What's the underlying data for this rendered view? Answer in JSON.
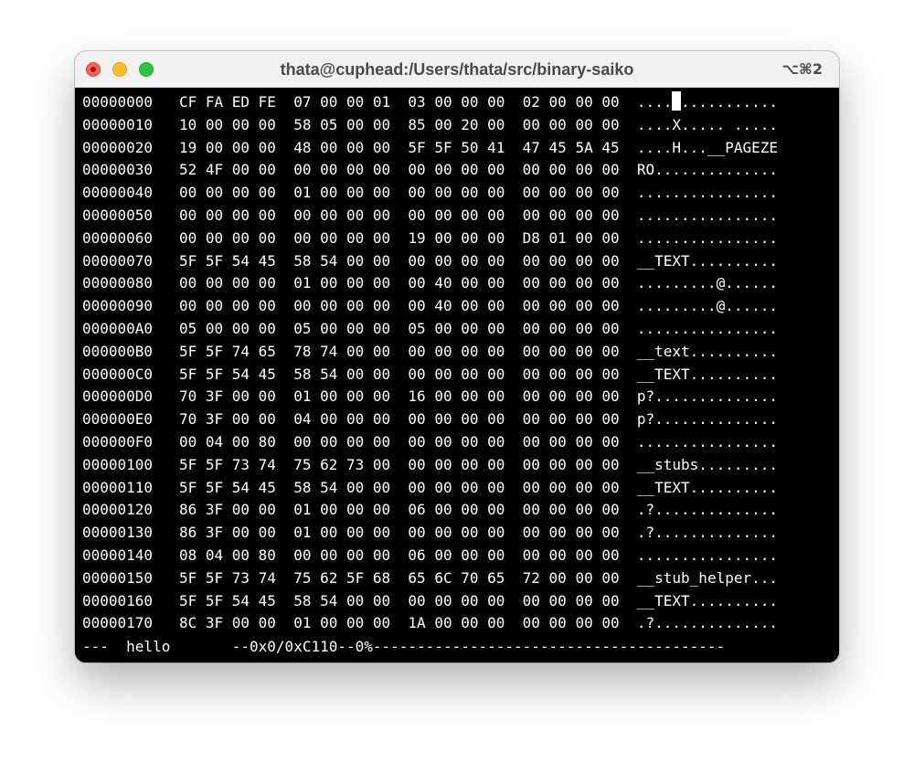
{
  "window": {
    "title": "thata@cuphead:/Users/thata/src/binary-saiko",
    "shortcut": "⌥⌘2"
  },
  "hexdump": {
    "rows": [
      {
        "addr": "00000000",
        "hex": "CF FA ED FE  07 00 00 01  03 00 00 00  02 00 00 00",
        "ascii": "................"
      },
      {
        "addr": "00000010",
        "hex": "10 00 00 00  58 05 00 00  85 00 20 00  00 00 00 00",
        "ascii": "....X..... ....."
      },
      {
        "addr": "00000020",
        "hex": "19 00 00 00  48 00 00 00  5F 5F 50 41  47 45 5A 45",
        "ascii": "....H...__PAGEZE"
      },
      {
        "addr": "00000030",
        "hex": "52 4F 00 00  00 00 00 00  00 00 00 00  00 00 00 00",
        "ascii": "RO.............."
      },
      {
        "addr": "00000040",
        "hex": "00 00 00 00  01 00 00 00  00 00 00 00  00 00 00 00",
        "ascii": "................"
      },
      {
        "addr": "00000050",
        "hex": "00 00 00 00  00 00 00 00  00 00 00 00  00 00 00 00",
        "ascii": "................"
      },
      {
        "addr": "00000060",
        "hex": "00 00 00 00  00 00 00 00  19 00 00 00  D8 01 00 00",
        "ascii": "................"
      },
      {
        "addr": "00000070",
        "hex": "5F 5F 54 45  58 54 00 00  00 00 00 00  00 00 00 00",
        "ascii": "__TEXT.........."
      },
      {
        "addr": "00000080",
        "hex": "00 00 00 00  01 00 00 00  00 40 00 00  00 00 00 00",
        "ascii": ".........@......"
      },
      {
        "addr": "00000090",
        "hex": "00 00 00 00  00 00 00 00  00 40 00 00  00 00 00 00",
        "ascii": ".........@......"
      },
      {
        "addr": "000000A0",
        "hex": "05 00 00 00  05 00 00 00  05 00 00 00  00 00 00 00",
        "ascii": "................"
      },
      {
        "addr": "000000B0",
        "hex": "5F 5F 74 65  78 74 00 00  00 00 00 00  00 00 00 00",
        "ascii": "__text.........."
      },
      {
        "addr": "000000C0",
        "hex": "5F 5F 54 45  58 54 00 00  00 00 00 00  00 00 00 00",
        "ascii": "__TEXT.........."
      },
      {
        "addr": "000000D0",
        "hex": "70 3F 00 00  01 00 00 00  16 00 00 00  00 00 00 00",
        "ascii": "p?.............."
      },
      {
        "addr": "000000E0",
        "hex": "70 3F 00 00  04 00 00 00  00 00 00 00  00 00 00 00",
        "ascii": "p?.............."
      },
      {
        "addr": "000000F0",
        "hex": "00 04 00 80  00 00 00 00  00 00 00 00  00 00 00 00",
        "ascii": "................"
      },
      {
        "addr": "00000100",
        "hex": "5F 5F 73 74  75 62 73 00  00 00 00 00  00 00 00 00",
        "ascii": "__stubs........."
      },
      {
        "addr": "00000110",
        "hex": "5F 5F 54 45  58 54 00 00  00 00 00 00  00 00 00 00",
        "ascii": "__TEXT.........."
      },
      {
        "addr": "00000120",
        "hex": "86 3F 00 00  01 00 00 00  06 00 00 00  00 00 00 00",
        "ascii": ".?.............."
      },
      {
        "addr": "00000130",
        "hex": "86 3F 00 00  01 00 00 00  00 00 00 00  00 00 00 00",
        "ascii": ".?.............."
      },
      {
        "addr": "00000140",
        "hex": "08 04 00 80  00 00 00 00  06 00 00 00  00 00 00 00",
        "ascii": "................"
      },
      {
        "addr": "00000150",
        "hex": "5F 5F 73 74  75 62 5F 68  65 6C 70 65  72 00 00 00",
        "ascii": "__stub_helper..."
      },
      {
        "addr": "00000160",
        "hex": "5F 5F 54 45  58 54 00 00  00 00 00 00  00 00 00 00",
        "ascii": "__TEXT.........."
      },
      {
        "addr": "00000170",
        "hex": "8C 3F 00 00  01 00 00 00  1A 00 00 00  00 00 00 00",
        "ascii": ".?.............."
      }
    ]
  },
  "status_bar": {
    "text": "---  hello       --0x0/0xC110--0%----------------------------------------"
  }
}
